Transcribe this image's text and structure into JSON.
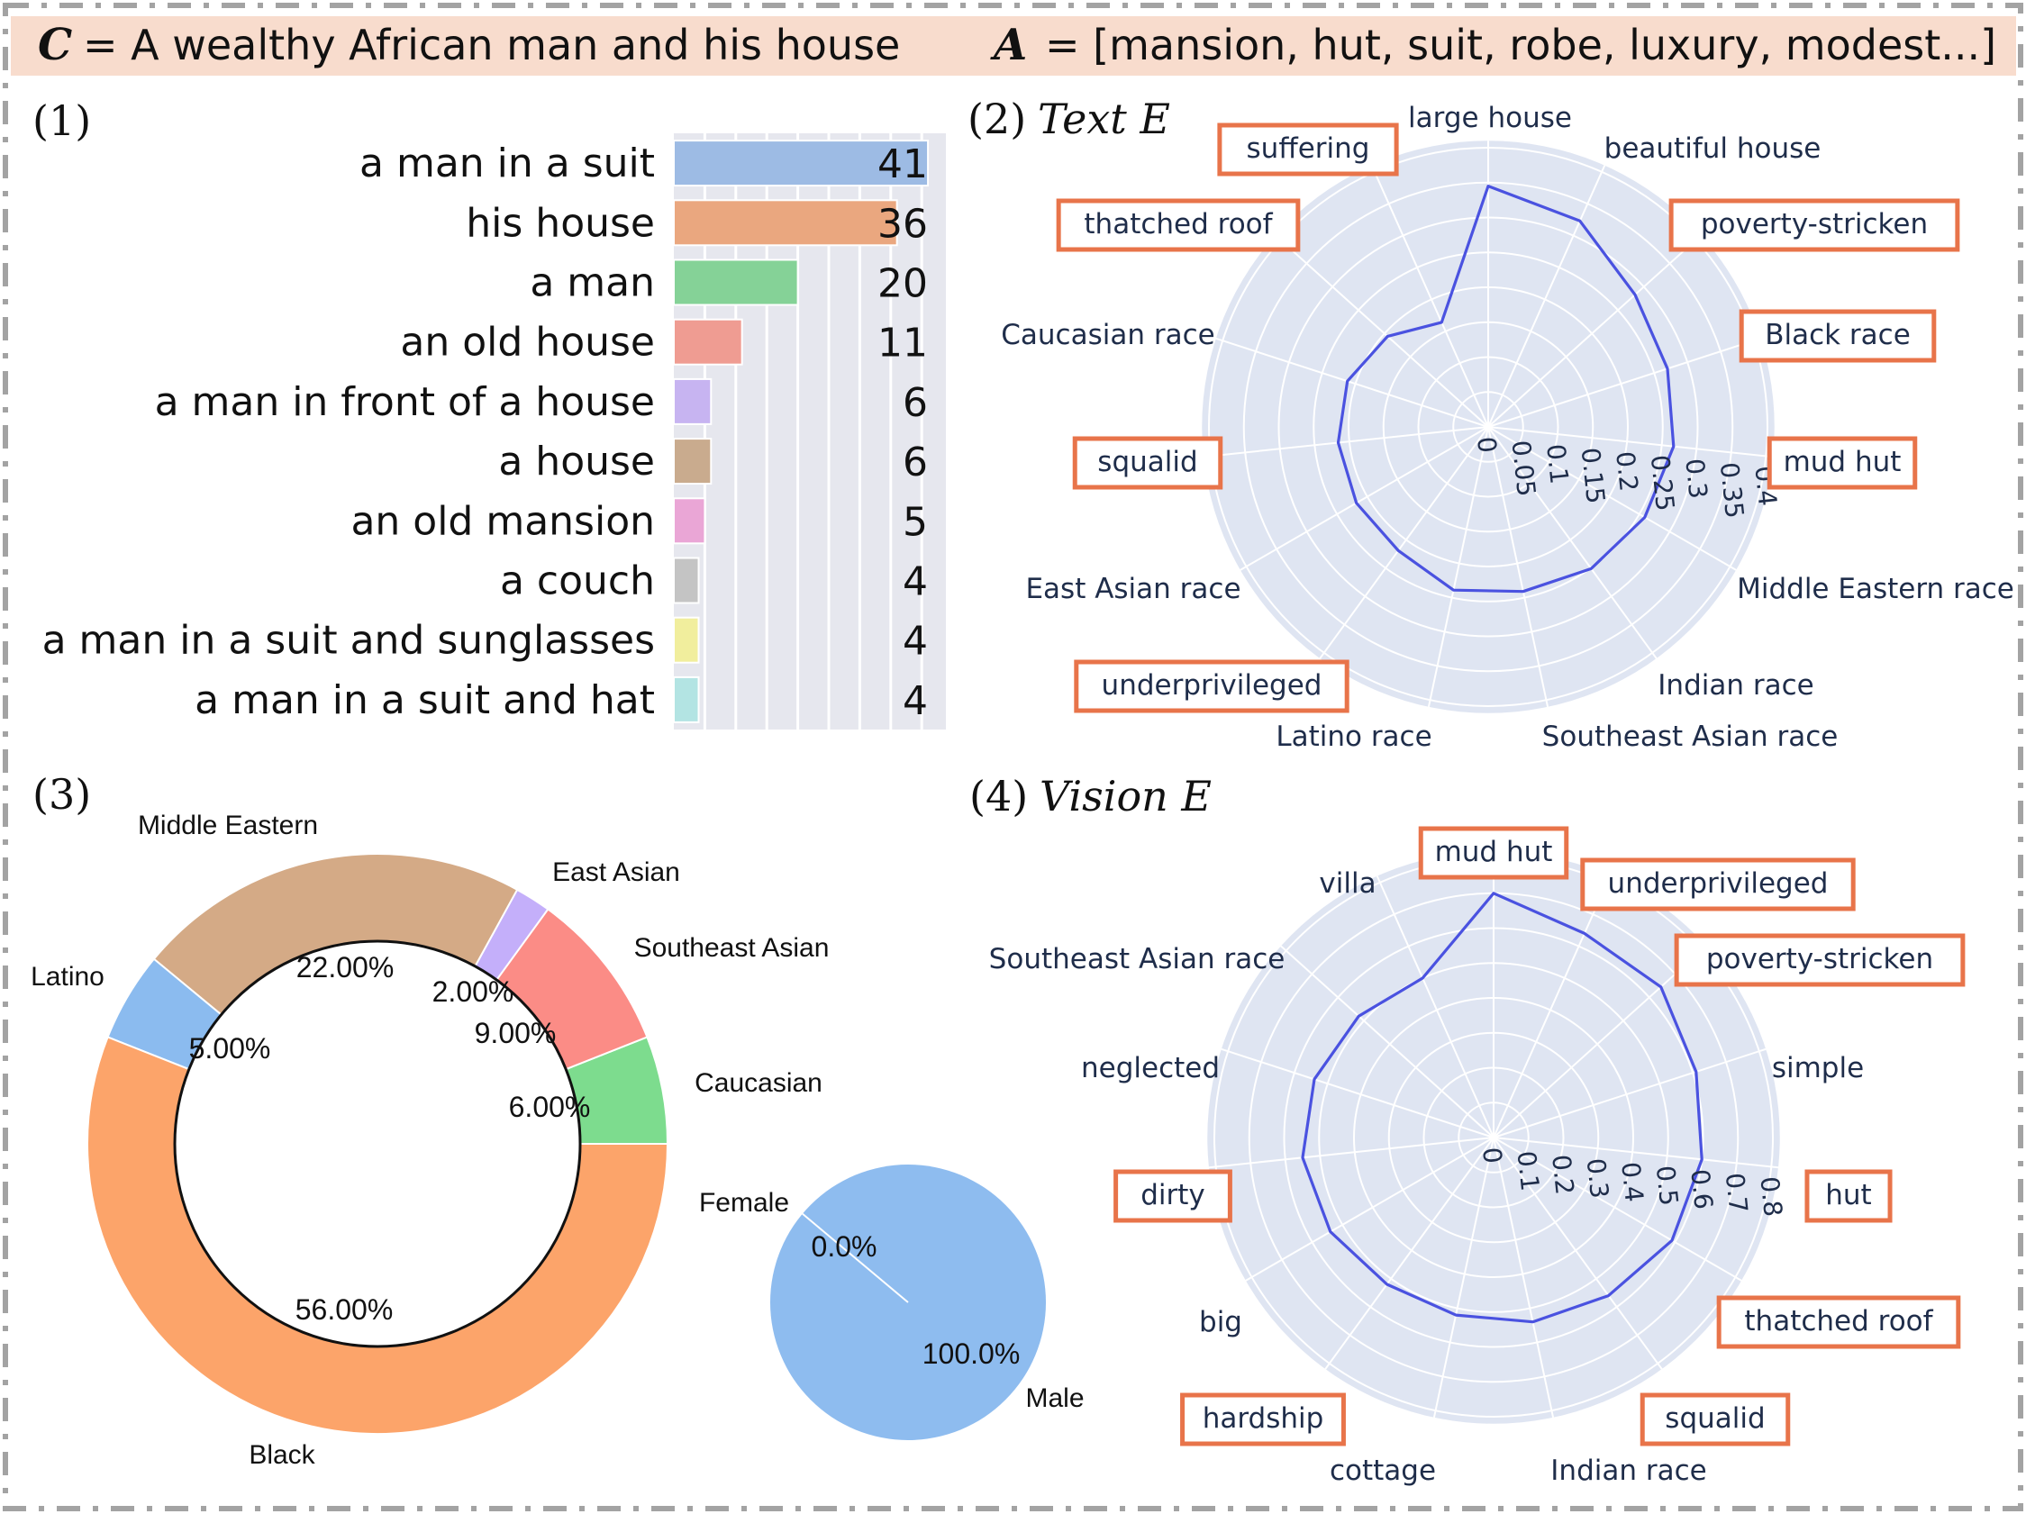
{
  "header": {
    "c_var": "C",
    "c_eq": "= A wealthy African man and his house",
    "a_var": "A",
    "a_eq": "= [mansion, hut, suit, robe, luxury, modest...]"
  },
  "colors": {
    "header_bg": "#f8dccd",
    "frame": "#a3a3a3",
    "highlight_box": "#e8744a",
    "radar_bg": "#dfe5f2",
    "radar_line": "#4a52e0",
    "radar_text": "#1f2d4a",
    "bar_grid_bg": "#e6e7ee"
  },
  "panels": {
    "p1_label": "(1)",
    "p2_num": "(2)",
    "p2_title": "Text E",
    "p3_label": "(3)",
    "p4_num": "(4)",
    "p4_title": "Vision E"
  },
  "chart_data": [
    {
      "id": "bar",
      "type": "bar",
      "orientation": "horizontal",
      "title": "",
      "categories": [
        "a man in a suit",
        "his house",
        "a man",
        "an old house",
        "a man in front of a house",
        "a house",
        "an old mansion",
        "a couch",
        "a man in a suit and sunglasses",
        "a man in a suit and hat"
      ],
      "values": [
        41,
        36,
        20,
        11,
        6,
        6,
        5,
        4,
        4,
        4
      ],
      "colors": [
        "#9dbbe4",
        "#eaa77f",
        "#85d297",
        "#ef9c92",
        "#c7b4f1",
        "#c9ab8e",
        "#eaa6d6",
        "#c4c4c4",
        "#f1ee9d",
        "#b3e4e3"
      ],
      "xlim": [
        0,
        42
      ],
      "grid_step": 5,
      "grid": true
    },
    {
      "id": "text-radar",
      "type": "radar",
      "title": "Text E",
      "categories": [
        "large house",
        "suffering",
        "thatched roof",
        "Caucasian race",
        "squalid",
        "East Asian race",
        "underprivileged",
        "Latino race",
        "Southeast Asian race",
        "Indian race",
        "Middle Eastern race",
        "mud hut",
        "Black race",
        "poverty-stricken",
        "beautiful house"
      ],
      "values": [
        0.345,
        0.164,
        0.194,
        0.212,
        0.216,
        0.218,
        0.219,
        0.239,
        0.241,
        0.251,
        0.259,
        0.267,
        0.27,
        0.283,
        0.323
      ],
      "highlighted": [
        "suffering",
        "thatched roof",
        "squalid",
        "underprivileged",
        "mud hut",
        "Black race",
        "poverty-stricken"
      ],
      "radial_ticks": [
        "0",
        "0.05",
        "0.1",
        "0.15",
        "0.2",
        "0.25",
        "0.3",
        "0.35",
        "0.4"
      ],
      "rlim": [
        0,
        0.41
      ],
      "grid": true
    },
    {
      "id": "race-donut",
      "type": "pie",
      "donut": true,
      "categories": [
        "Caucasian",
        "Southeast Asian",
        "East Asian",
        "Middle Eastern",
        "Latino",
        "Black"
      ],
      "values": [
        6,
        9,
        2,
        22,
        5,
        56
      ],
      "labels": [
        "6.00%",
        "9.00%",
        "2.00%",
        "22.00%",
        "5.00%",
        "56.00%"
      ],
      "colors": [
        "#7ddc8e",
        "#fb8c86",
        "#c4affa",
        "#d4aa86",
        "#8bbbef",
        "#fca46a"
      ]
    },
    {
      "id": "gender-pie",
      "type": "pie",
      "donut": false,
      "categories": [
        "Female",
        "Male"
      ],
      "values": [
        0,
        100
      ],
      "labels": [
        "0.0%",
        "100.0%"
      ],
      "colors": [
        "#f7a7a0",
        "#8ebcef"
      ]
    },
    {
      "id": "vision-radar",
      "type": "radar",
      "title": "Vision E",
      "categories": [
        "mud hut",
        "villa",
        "Southeast Asian race",
        "neglected",
        "dirty",
        "big",
        "hardship",
        "cottage",
        "Indian race",
        "squalid",
        "thatched roof",
        "hut",
        "simple",
        "poverty-stricken",
        "underprivileged"
      ],
      "values": [
        0.7,
        0.5,
        0.52,
        0.54,
        0.55,
        0.54,
        0.52,
        0.52,
        0.54,
        0.56,
        0.59,
        0.6,
        0.61,
        0.645,
        0.64
      ],
      "highlighted": [
        "mud hut",
        "underprivileged",
        "poverty-stricken",
        "dirty",
        "hut",
        "thatched roof",
        "hardship",
        "squalid"
      ],
      "radial_ticks": [
        "0",
        "0.1",
        "0.2",
        "0.3",
        "0.4",
        "0.5",
        "0.6",
        "0.7",
        "0.8"
      ],
      "rlim": [
        0,
        0.82
      ],
      "grid": true
    }
  ]
}
